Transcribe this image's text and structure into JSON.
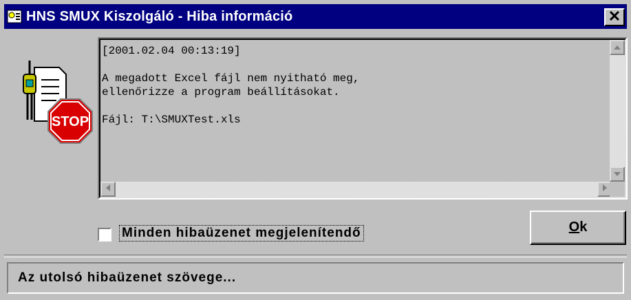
{
  "window": {
    "title": "HNS SMUX Kiszolgáló - Hiba információ",
    "close_glyph": "✕"
  },
  "message": {
    "lines": [
      "[2001.02.04 00:13:19]",
      "",
      "A megadott Excel fájl nem nyitható meg,",
      "ellenőrizze a program beállításokat.",
      "",
      "Fájl: T:\\SMUXTest.xls"
    ]
  },
  "checkbox": {
    "label": "Minden hibaüzenet megjelenítendő",
    "checked": false
  },
  "ok_button": {
    "mnemonic": "O",
    "rest": "k"
  },
  "status": {
    "text": "Az utolsó hibaüzenet szövege..."
  },
  "icons": {
    "app": "app-icon",
    "stop": "stop-sign-icon",
    "close": "close-icon"
  },
  "colors": {
    "titlebar": "#000080",
    "face": "#c0c0c0",
    "stop_red": "#d80000"
  }
}
